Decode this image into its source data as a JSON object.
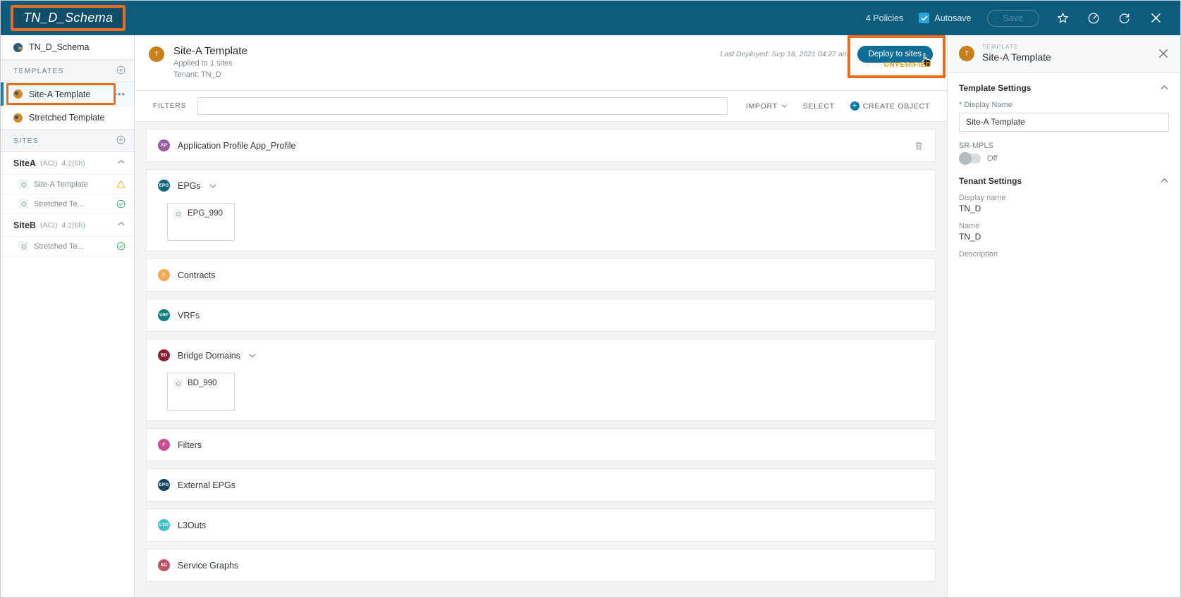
{
  "topbar": {
    "schema_title": "TN_D_Schema",
    "policies_count": "4 Policies",
    "autosave_label": "Autosave",
    "save_label": "Save",
    "icons": [
      "star-icon",
      "help-icon",
      "refresh-icon",
      "close-icon"
    ],
    "background_color": "#0d5b7d",
    "highlight_color": "#ef6c1a"
  },
  "sidebar": {
    "schema_name": "TN_D_Schema",
    "templates_header": "TEMPLATES",
    "templates": [
      {
        "label": "Site-A Template",
        "selected": true,
        "highlighted": true
      },
      {
        "label": "Stretched Template",
        "selected": false,
        "highlighted": false
      }
    ],
    "sites_header": "SITES",
    "sites": [
      {
        "name": "SiteA",
        "type": "(ACI)",
        "version": "4.2(6h)",
        "templates": [
          {
            "label": "Site-A Template",
            "status": "warning"
          },
          {
            "label": "Stretched Te...",
            "status": "ok"
          }
        ]
      },
      {
        "name": "SiteB",
        "type": "(ACI)",
        "version": "4.2(6h)",
        "templates": [
          {
            "label": "Stretched Te...",
            "status": "ok"
          }
        ]
      }
    ]
  },
  "template_header": {
    "avatar_letter": "T",
    "title": "Site-A Template",
    "applied_to": "Applied to 1 sites",
    "tenant": "Tenant: TN_D",
    "last_deployed": "Last Deployed: Sep 18, 2021 04:27 am",
    "deploy_button": "Deploy to sites",
    "unverified_label": "UNVERIFIED"
  },
  "filters": {
    "label": "FILTERS",
    "value": "",
    "placeholder": "",
    "import_label": "IMPORT",
    "select_label": "SELECT",
    "create_object_label": "CREATE OBJECT"
  },
  "objects": [
    {
      "label": "Application Profile App_Profile",
      "badge": "AP",
      "color": "#9a5ca8",
      "expandable": false,
      "deletable": true,
      "children": []
    },
    {
      "label": "EPGs",
      "badge": "EPG",
      "color": "#11657f",
      "expandable": true,
      "deletable": false,
      "children": [
        {
          "label": "EPG_990"
        }
      ]
    },
    {
      "label": "Contracts",
      "badge": "C",
      "color": "#f3a952",
      "expandable": false,
      "deletable": false,
      "children": []
    },
    {
      "label": "VRFs",
      "badge": "VRF",
      "color": "#0f8080",
      "expandable": false,
      "deletable": false,
      "children": []
    },
    {
      "label": "Bridge Domains",
      "badge": "BD",
      "color": "#8c1d2e",
      "expandable": true,
      "deletable": false,
      "children": [
        {
          "label": "BD_990"
        }
      ]
    },
    {
      "label": "Filters",
      "badge": "F",
      "color": "#c84d8f",
      "expandable": false,
      "deletable": false,
      "children": []
    },
    {
      "label": "External EPGs",
      "badge": "EPG",
      "color": "#13455f",
      "expandable": false,
      "deletable": false,
      "children": []
    },
    {
      "label": "L3Outs",
      "badge": "L3O",
      "color": "#3cc0ce",
      "expandable": false,
      "deletable": false,
      "children": []
    },
    {
      "label": "Service Graphs",
      "badge": "SG",
      "color": "#bb5565",
      "expandable": false,
      "deletable": false,
      "children": []
    }
  ],
  "right_panel": {
    "avatar_letter": "T",
    "kicker": "TEMPLATE",
    "title": "Site-A Template",
    "template_settings": {
      "heading": "Template Settings",
      "display_name_label": "Display Name",
      "display_name_required": "*",
      "display_name_value": "Site-A Template",
      "srmpls_label": "SR-MPLS",
      "srmpls_state": "Off"
    },
    "tenant_settings": {
      "heading": "Tenant Settings",
      "display_name_label": "Display name",
      "display_name_value": "TN_D",
      "name_label": "Name",
      "name_value": "TN_D",
      "description_label": "Description",
      "description_value": ""
    }
  }
}
